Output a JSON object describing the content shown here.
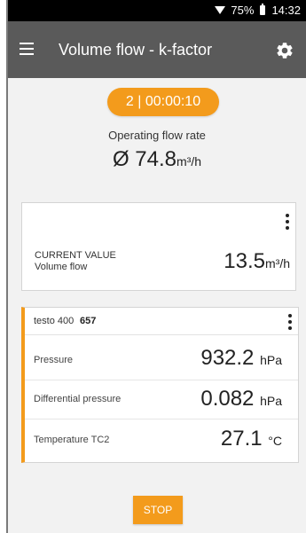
{
  "status_bar": {
    "battery_percent": "75%",
    "time": "14:32",
    "icons": [
      "wifi-icon",
      "battery-icon"
    ]
  },
  "app_bar": {
    "title": "Volume flow - k-factor",
    "menu_icon": "hamburger-menu-icon",
    "settings_icon": "gear-icon"
  },
  "measurement": {
    "timer": "2 | 00:00:10",
    "operating_label": "Operating flow rate",
    "operating_value": "Ø 74.8",
    "operating_unit": "m³/h"
  },
  "current_value_card": {
    "label_line1": "CURRENT VALUE",
    "label_line2": "Volume flow",
    "value": "13.5",
    "unit": "m³/h"
  },
  "device_card": {
    "device_name": "testo 400",
    "serial": "657",
    "accent_color": "#f39b1c",
    "rows": [
      {
        "label": "Pressure",
        "value": "932.2",
        "unit": "hPa"
      },
      {
        "label": "Differential pressure",
        "value": "0.082",
        "unit": "hPa"
      },
      {
        "label": "Temperature TC2",
        "value": "27.1",
        "unit": "°C"
      }
    ]
  },
  "actions": {
    "stop_label": "STOP"
  },
  "colors": {
    "accent": "#f39b1c",
    "app_bar": "#5a5a5a",
    "status_bar": "#000000"
  }
}
